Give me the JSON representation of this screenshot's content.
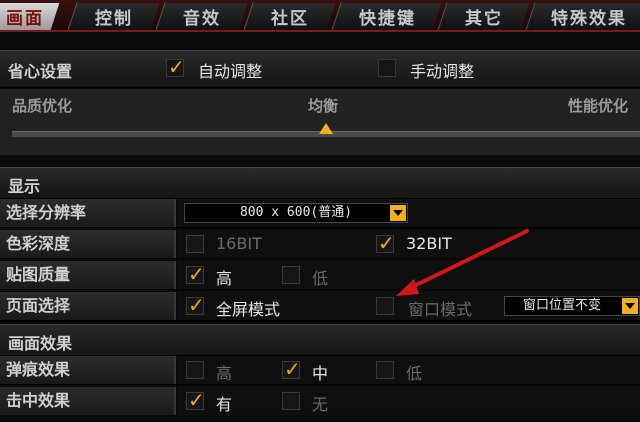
{
  "tabs": [
    {
      "label": "画面",
      "active": true
    },
    {
      "label": "控制",
      "active": false
    },
    {
      "label": "音效",
      "active": false
    },
    {
      "label": "社区",
      "active": false
    },
    {
      "label": "快捷键",
      "active": false
    },
    {
      "label": "其它",
      "active": false
    },
    {
      "label": "特殊效果",
      "active": false
    }
  ],
  "easy": {
    "title": "省心设置",
    "auto_label": "自动调整",
    "auto_checked": true,
    "manual_label": "手动调整",
    "manual_checked": false
  },
  "quality_slider": {
    "left_label": "品质优化",
    "middle_label": "均衡",
    "right_label": "性能优化",
    "value": "均衡"
  },
  "display": {
    "title": "显示",
    "resolution": {
      "label": "选择分辨率",
      "value": "800 x 600(普通)"
    },
    "color_depth": {
      "label": "色彩深度",
      "opt16": "16BIT",
      "opt16_checked": false,
      "opt32": "32BIT",
      "opt32_checked": true
    },
    "texture": {
      "label": "贴图质量",
      "high": "高",
      "high_checked": true,
      "low": "低",
      "low_checked": false
    },
    "page": {
      "label": "页面选择",
      "fullscreen": "全屏模式",
      "fullscreen_checked": true,
      "window": "窗口模式",
      "window_checked": false,
      "window_pos": "窗口位置不变"
    }
  },
  "effects": {
    "title": "画面效果",
    "bullet": {
      "label": "弹痕效果",
      "high": "高",
      "high_checked": false,
      "mid": "中",
      "mid_checked": true,
      "low": "低",
      "low_checked": false
    },
    "hit": {
      "label": "击中效果",
      "yes": "有",
      "yes_checked": true,
      "no": "无",
      "no_checked": false
    }
  },
  "colors": {
    "accent": "#f2b01f",
    "arrow": "#d01818",
    "tab_border": "#7a1a1a"
  }
}
